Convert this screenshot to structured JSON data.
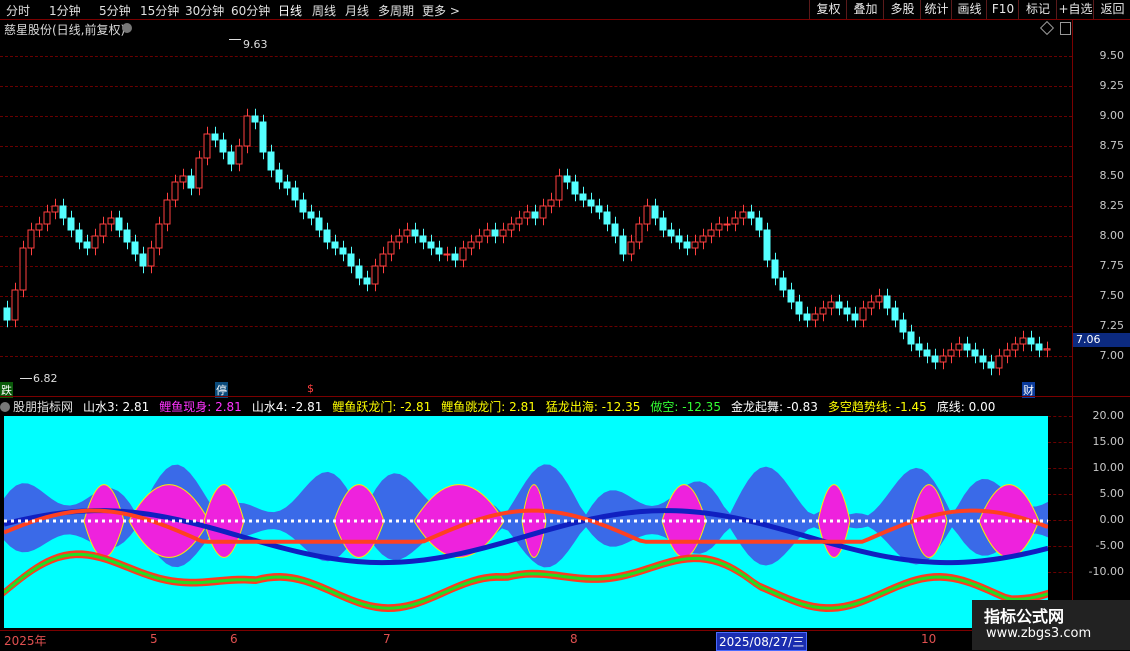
{
  "toolbar": {
    "tabs": [
      "分时",
      "1分钟",
      "5分钟",
      "15分钟",
      "30分钟",
      "60分钟",
      "日线",
      "周线",
      "月线",
      "多周期",
      "更多 >"
    ],
    "active_tab": "日线",
    "right_buttons": [
      "复权",
      "叠加",
      "多股",
      "统计",
      "画线",
      "F10",
      "标记",
      "+自选",
      "返回"
    ]
  },
  "price_panel": {
    "title": "慈星股份(日线,前复权)",
    "axis_labels": [
      "9.50",
      "9.25",
      "9.00",
      "8.75",
      "8.50",
      "8.25",
      "8.00",
      "7.75",
      "7.50",
      "7.25",
      "7.00"
    ],
    "current_price": "7.06",
    "high_label": "9.63",
    "low_label": "6.82",
    "markers": {
      "left": "跌",
      "mid": "停",
      "dollar": "$",
      "right": "财"
    }
  },
  "indicator": {
    "name": "股朋指标网",
    "items": [
      {
        "label": "山水3: 2.81",
        "color": "#ffffff"
      },
      {
        "label": "鲤鱼现身: 2.81",
        "color": "#ff33ff"
      },
      {
        "label": "山水4: -2.81",
        "color": "#ffffff"
      },
      {
        "label": "鲤鱼跃龙门: -2.81",
        "color": "#ffff00"
      },
      {
        "label": "鲤鱼跳龙门: 2.81",
        "color": "#ffff00"
      },
      {
        "label": "猛龙出海: -12.35",
        "color": "#ffff00"
      },
      {
        "label": "做空: -12.35",
        "color": "#33ff33"
      },
      {
        "label": "金龙起舞: -0.83",
        "color": "#ffffff"
      },
      {
        "label": "多空趋势线: -1.45",
        "color": "#ffff00"
      },
      {
        "label": "底线: 0.00",
        "color": "#ffffff"
      }
    ],
    "axis_labels": [
      "20.00",
      "15.00",
      "10.00",
      "5.00",
      "0.00",
      "-5.00",
      "-10.00"
    ]
  },
  "date_axis": {
    "labels": [
      "2025年",
      "5",
      "6",
      "7",
      "8",
      "10"
    ],
    "selected_date": "2025/08/27/三"
  },
  "watermark": {
    "line1": "指标公式网",
    "line2": "www.zbgs3.com"
  },
  "colors": {
    "up": "#ff4040",
    "down": "#54ffff",
    "grid": "#6a0000",
    "fill_bg": "#00ffff"
  },
  "chart_data": {
    "type": "candlestick",
    "price_range": [
      6.82,
      9.63
    ],
    "closes": [
      7.3,
      7.55,
      7.9,
      8.05,
      8.1,
      8.2,
      8.25,
      8.15,
      8.05,
      7.95,
      7.9,
      8.0,
      8.1,
      8.15,
      8.05,
      7.95,
      7.85,
      7.75,
      7.9,
      8.1,
      8.3,
      8.45,
      8.5,
      8.4,
      8.65,
      8.85,
      8.8,
      8.7,
      8.6,
      8.75,
      9.0,
      8.95,
      8.7,
      8.55,
      8.45,
      8.4,
      8.3,
      8.2,
      8.15,
      8.05,
      7.95,
      7.9,
      7.85,
      7.75,
      7.65,
      7.6,
      7.75,
      7.85,
      7.95,
      8.0,
      8.05,
      8.0,
      7.95,
      7.9,
      7.85,
      7.85,
      7.8,
      7.9,
      7.95,
      8.0,
      8.05,
      8.0,
      8.05,
      8.1,
      8.15,
      8.2,
      8.15,
      8.25,
      8.3,
      8.5,
      8.45,
      8.35,
      8.3,
      8.25,
      8.2,
      8.1,
      8.0,
      7.85,
      7.95,
      8.1,
      8.25,
      8.15,
      8.05,
      8.0,
      7.95,
      7.9,
      7.95,
      8.0,
      8.05,
      8.1,
      8.1,
      8.15,
      8.2,
      8.15,
      8.05,
      7.8,
      7.65,
      7.55,
      7.45,
      7.35,
      7.3,
      7.35,
      7.4,
      7.45,
      7.4,
      7.35,
      7.3,
      7.4,
      7.45,
      7.5,
      7.4,
      7.3,
      7.2,
      7.1,
      7.05,
      7.0,
      6.95,
      7.0,
      7.05,
      7.1,
      7.05,
      7.0,
      6.95,
      6.9,
      7.0,
      7.05,
      7.1,
      7.15,
      7.1,
      7.05,
      7.06
    ]
  }
}
